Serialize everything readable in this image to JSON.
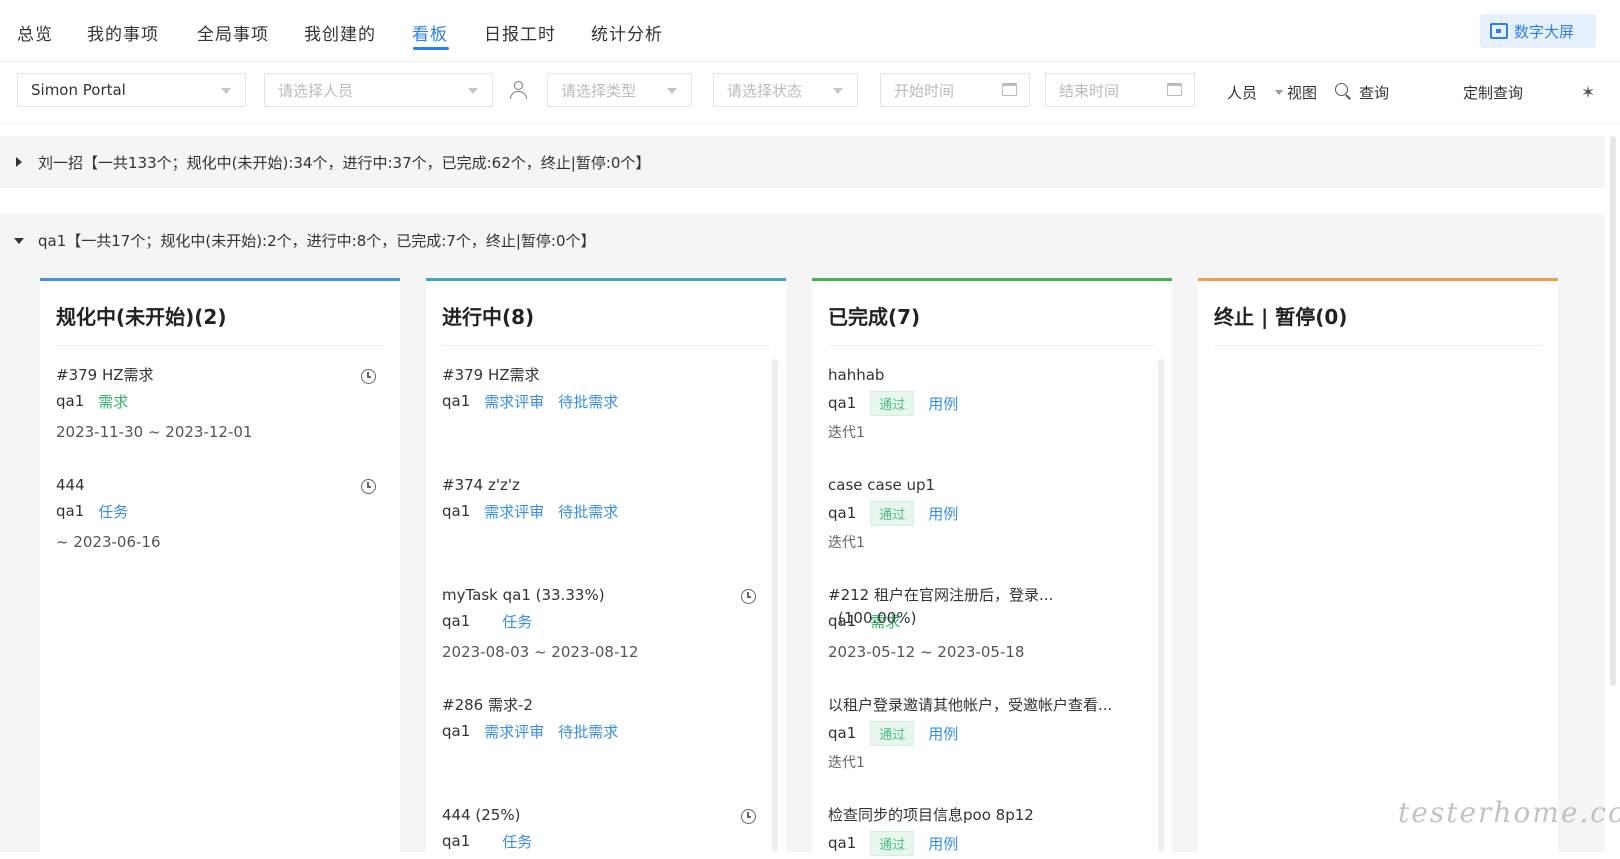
{
  "nav": {
    "tabs": [
      "总览",
      "我的事项",
      "全局事项",
      "我创建的",
      "看板",
      "日报工时",
      "统计分析"
    ],
    "active_tab": "看板",
    "dashboard_button": "数字大屏"
  },
  "filters": {
    "project": "Simon Portal",
    "person_placeholder": "请选择人员",
    "type_placeholder": "请选择类型",
    "status_placeholder": "请选择状态",
    "start_placeholder": "开始时间",
    "end_placeholder": "结束时间",
    "group_by": "人员",
    "view": "视图",
    "query": "查询",
    "custom_query": "定制查询"
  },
  "groups": [
    {
      "label": "刘一招【一共133个；规化中(未开始):34个，进行中:37个，已完成:62个，终止|暂停:0个】",
      "expanded": false
    },
    {
      "label": "qa1【一共17个；规化中(未开始):2个，进行中:8个，已完成:7个，终止|暂停:0个】",
      "expanded": true
    }
  ],
  "columns": [
    {
      "title": "规化中(未开始)(2)",
      "accent": "#4a90e2",
      "cards": [
        {
          "title": "#379 HZ需求",
          "owner": "qa1",
          "tags": [
            {
              "text": "需求",
              "color": "green"
            }
          ],
          "date": "2023-11-30 ~ 2023-12-01",
          "clock": true
        },
        {
          "title": "444",
          "owner": "qa1",
          "tags": [
            {
              "text": "任务",
              "color": "blue"
            }
          ],
          "date": "~ 2023-06-16",
          "clock": true
        }
      ]
    },
    {
      "title": "进行中(8)",
      "accent": "#3aa6c8",
      "cards": [
        {
          "title": "#379 HZ需求",
          "owner": "qa1",
          "tags": [
            {
              "text": "需求评审",
              "color": "blue"
            },
            {
              "text": "待批需求",
              "color": "blue"
            }
          ]
        },
        {
          "title": "#374 z'z'z",
          "owner": "qa1",
          "tags": [
            {
              "text": "需求评审",
              "color": "blue"
            },
            {
              "text": "待批需求",
              "color": "blue"
            }
          ]
        },
        {
          "title": "myTask qa1  (33.33%)",
          "owner": "qa1",
          "tags": [
            {
              "text": "任务",
              "color": "blue"
            }
          ],
          "date": "2023-08-03 ~ 2023-08-12",
          "clock": true
        },
        {
          "title": "#286 需求-2",
          "owner": "qa1",
          "tags": [
            {
              "text": "需求评审",
              "color": "blue"
            },
            {
              "text": "待批需求",
              "color": "blue"
            }
          ]
        },
        {
          "title": "444  (25%)",
          "owner": "qa1",
          "tags": [
            {
              "text": "任务",
              "color": "blue"
            }
          ],
          "clock": true
        }
      ]
    },
    {
      "title": "已完成(7)",
      "accent": "#4caf50",
      "cards": [
        {
          "title": "hahhab",
          "owner": "qa1",
          "badge": "通过",
          "tags": [
            {
              "text": "用例",
              "color": "blue"
            }
          ],
          "iter": "迭代1"
        },
        {
          "title": "case case up1",
          "owner": "qa1",
          "badge": "通过",
          "tags": [
            {
              "text": "用例",
              "color": "blue"
            }
          ],
          "iter": "迭代1"
        },
        {
          "title": "#212 租户在官网注册后，登录...",
          "owner": "qa1",
          "tags": [
            {
              "text": "需求",
              "color": "green"
            }
          ],
          "overlay": "(100.00%)",
          "date": "2023-05-12 ~ 2023-05-18"
        },
        {
          "title": "以租户登录邀请其他帐户，受邀帐户查看...",
          "owner": "qa1",
          "badge": "通过",
          "tags": [
            {
              "text": "用例",
              "color": "blue"
            }
          ],
          "iter": "迭代1"
        },
        {
          "title": "检查同步的项目信息poo 8p12",
          "owner": "qa1",
          "badge": "通过",
          "tags": [
            {
              "text": "用例",
              "color": "blue"
            }
          ]
        }
      ]
    },
    {
      "title": "终止 | 暂停(0)",
      "accent": "#f0a040",
      "cards": []
    }
  ],
  "watermark": "testerhome.com"
}
